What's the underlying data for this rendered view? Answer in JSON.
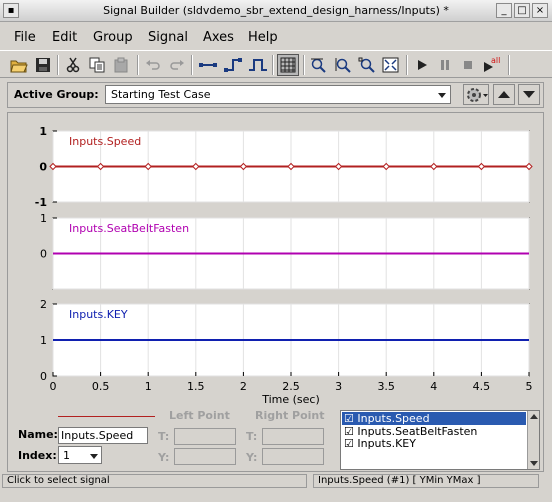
{
  "window": {
    "title": "Signal Builder (sldvdemo_sbr_extend_design_harness/Inputs) *"
  },
  "menu": [
    {
      "label": "File"
    },
    {
      "label": "Edit"
    },
    {
      "label": "Group"
    },
    {
      "label": "Signal"
    },
    {
      "label": "Axes"
    },
    {
      "label": "Help"
    }
  ],
  "group": {
    "label": "Active Group:",
    "selected": "Starting Test Case"
  },
  "plots": {
    "xlabel": "Time (sec)",
    "x_ticks": [
      "0",
      "0.5",
      "1",
      "1.5",
      "2",
      "2.5",
      "3",
      "3.5",
      "4",
      "4.5",
      "5"
    ],
    "signals": [
      {
        "name": "Inputs.Speed",
        "color": "#b22020",
        "y_ticks": [
          "1",
          "0",
          "-1"
        ],
        "selected": true
      },
      {
        "name": "Inputs.SeatBeltFasten",
        "color": "#b000b0",
        "y_ticks": [
          "1",
          "0"
        ]
      },
      {
        "name": "Inputs.KEY",
        "color": "#1020b0",
        "y_ticks": [
          "2",
          "1",
          "0"
        ]
      }
    ]
  },
  "bottom": {
    "left_point": "Left Point",
    "right_point": "Right Point",
    "name_label": "Name:",
    "name_value": "Inputs.Speed",
    "index_label": "Index:",
    "index_value": "1",
    "t_label": "T:",
    "y_label": "Y:",
    "signal_list": [
      "Inputs.Speed",
      "Inputs.SeatBeltFasten",
      "Inputs.KEY"
    ]
  },
  "status": {
    "left": "Click to select signal",
    "right": "Inputs.Speed (#1)  [ YMin YMax ]"
  }
}
